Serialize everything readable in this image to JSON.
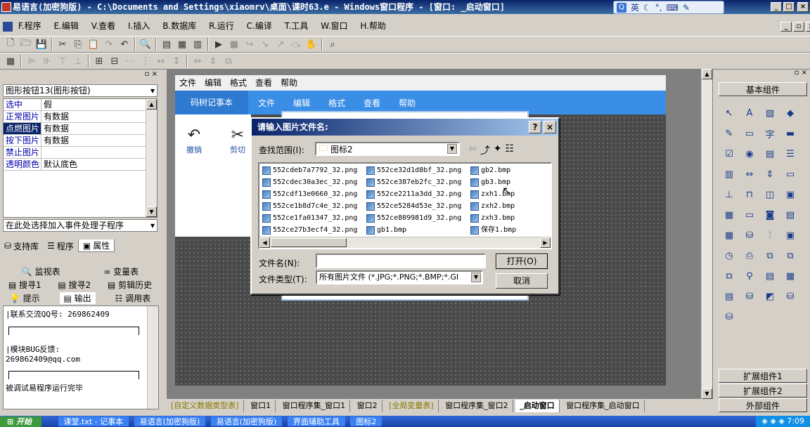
{
  "window": {
    "title": "易语言(加密狗版) - C:\\Documents and Settings\\xiaomrv\\桌面\\课时63.e - Windows窗口程序 - [窗口: _启动窗口]"
  },
  "ime": {
    "label": "英"
  },
  "menu": [
    "F.程序",
    "E.编辑",
    "V.查看",
    "I.插入",
    "B.数据库",
    "R.运行",
    "C.编译",
    "T.工具",
    "W.窗口",
    "H.帮助"
  ],
  "left": {
    "combo": "图形按钮13(图形按钮)",
    "props": [
      {
        "k": "选中",
        "v": "假"
      },
      {
        "k": "正常图片",
        "v": "有数据"
      },
      {
        "k": "点燃图片",
        "v": "有数据"
      },
      {
        "k": "按下图片",
        "v": "有数据"
      },
      {
        "k": "禁止图片",
        "v": ""
      },
      {
        "k": "透明颜色",
        "v": "默认底色"
      }
    ],
    "event_combo": "在此处选择加入事件处理子程序",
    "tabs": [
      "支持库",
      "程序",
      "属性"
    ],
    "tools": [
      "监视表",
      "变量表",
      "搜寻1",
      "搜寻2",
      "剪辑历史",
      "提示",
      "输出",
      "调用表"
    ],
    "output": {
      "qq_label": "|联系交流QQ号:",
      "qq": "269862409",
      "bug_label": "|模块BUG反馈:",
      "email": "269862409@qq.com",
      "status": "被调试易程序运行完毕"
    }
  },
  "form": {
    "menu": [
      "文件",
      "编辑",
      "格式",
      "查看",
      "帮助"
    ],
    "app_title": "码树记事本",
    "app_menu": [
      "文件",
      "编辑",
      "格式",
      "查看",
      "帮助"
    ],
    "undo": "撤销",
    "cut": "剪切"
  },
  "dialog": {
    "title": "请输入图片文件名:",
    "lookin_label": "查找范围(I):",
    "folder": "图标2",
    "files": [
      "552cdeb7a7792_32.png",
      "552cdec30a3ec_32.png",
      "552cdf13e0660_32.png",
      "552ce1b8d7c4e_32.png",
      "552ce1fa01347_32.png",
      "552ce27b3ecf4_32.png",
      "552ce32d1d8bf_32.png",
      "552ce387eb2fc_32.png",
      "552ce2211a3dd_32.png",
      "552ce5284d53e_32.png",
      "552ce809981d9_32.png",
      "gb1.bmp",
      "gb2.bmp",
      "gb3.bmp",
      "zxh1.bmp",
      "zxh2.bmp",
      "zxh3.bmp",
      "保存1.bmp"
    ],
    "filename_label": "文件名(N):",
    "filename_value": "",
    "filetype_label": "文件类型(T):",
    "filetype_value": "所有图片文件 (*.JPG;*.PNG;*.BMP;*.GI",
    "open": "打开(O)",
    "cancel": "取消"
  },
  "bottom_tabs": [
    "[自定义数据类型表]",
    "窗口1",
    "窗口程序集_窗口1",
    "窗口2",
    "[全局变量表]",
    "窗口程序集_窗口2",
    "_启动窗口",
    "窗口程序集_启动窗口"
  ],
  "right": {
    "header": "基本组件",
    "groups": [
      "扩展组件1",
      "扩展组件2",
      "外部组件"
    ]
  },
  "taskbar": {
    "start": "开始",
    "tasks": [
      "课堂.txt - 记事本",
      "易语言(加密狗版)",
      "易语言(加密狗版)",
      "界面辅助工具",
      "图标2"
    ],
    "time": "7:09"
  }
}
